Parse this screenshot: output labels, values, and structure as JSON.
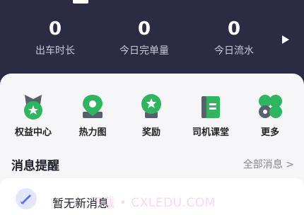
{
  "stats": [
    {
      "value": "0",
      "label": "出车时长"
    },
    {
      "value": "0",
      "label": "今日完单量"
    },
    {
      "value": "0",
      "label": "今日流水"
    }
  ],
  "grid": [
    {
      "label": "权益中心",
      "icon": "shield-star-icon"
    },
    {
      "label": "热力图",
      "icon": "map-pin-icon"
    },
    {
      "label": "奖励",
      "icon": "medal-icon"
    },
    {
      "label": "司机课堂",
      "icon": "book-icon"
    },
    {
      "label": "更多",
      "icon": "more-dots-icon"
    }
  ],
  "messages": {
    "title": "消息提醒",
    "all_label": "全部消息 >",
    "empty_text": "暂无新消息",
    "watermark": "下载 • CXLEDU.COM"
  },
  "colors": {
    "header_bg": "#2b2b44",
    "accent_green": "#2fb55f"
  }
}
